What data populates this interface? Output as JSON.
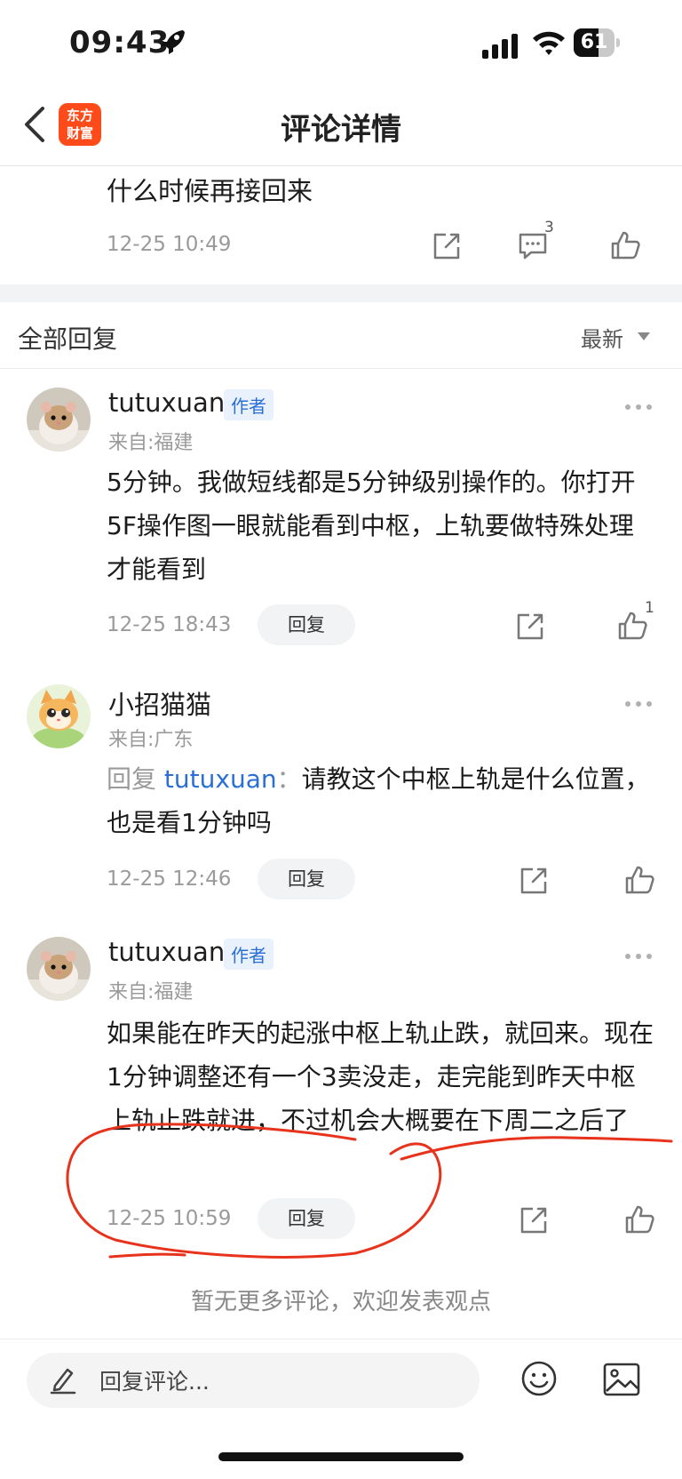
{
  "status_bar": {
    "time": "09:43",
    "battery": "61",
    "battery_level": 0.61
  },
  "header": {
    "title": "评论详情",
    "logo_line1": "东方",
    "logo_line2": "财富"
  },
  "original_comment": {
    "text": "什么时候再接回来",
    "time": "12-25 10:49",
    "reply_count": "3"
  },
  "replies_section": {
    "title": "全部回复",
    "sort_label": "最新"
  },
  "replies": [
    {
      "username": "tutuxuan",
      "tag": "作者",
      "location": "来自:福建",
      "text": "5分钟。我做短线都是5分钟级别操作的。你打开5F操作图一眼就能看到中枢，上轨要做特殊处理才能看到",
      "time": "12-25 18:43",
      "reply_label": "回复",
      "like_count": "1"
    },
    {
      "username": "小招猫猫",
      "location": "来自:广东",
      "reply_prefix": "回复",
      "reply_to": "tutuxuan",
      "reply_colon": "：",
      "text": "请教这个中枢上轨是什么位置，也是看1分钟吗",
      "time": "12-25 12:46",
      "reply_label": "回复"
    },
    {
      "username": "tutuxuan",
      "tag": "作者",
      "location": "来自:福建",
      "text": "如果能在昨天的起涨中枢上轨止跌，就回来。现在1分钟调整还有一个3卖没走，走完能到昨天中枢上轨止跌就进，不过机会大概要在下周二之后了",
      "time": "12-25 10:59",
      "reply_label": "回复"
    }
  ],
  "footer_note": "暂无更多评论，欢迎发表观点",
  "input": {
    "placeholder": "回复评论..."
  },
  "colors": {
    "accent_blue": "#2a6fd6",
    "logo_orange": "#ff4b1a",
    "annotation_red": "#e8331c"
  }
}
